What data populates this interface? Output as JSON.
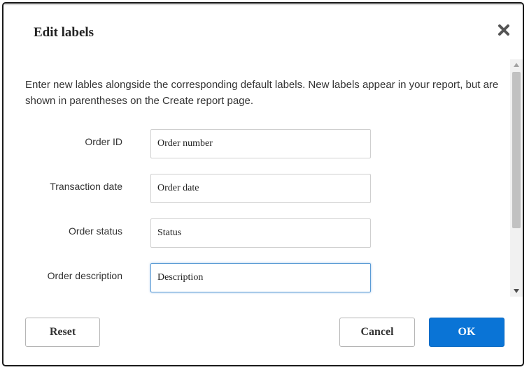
{
  "dialog": {
    "title": "Edit labels",
    "close_icon": "close-icon"
  },
  "intro_text": "Enter new lables alongside the corresponding default labels. New labels appear in your report, but are shown in parentheses on the Create report page.",
  "fields": [
    {
      "label": "Order ID",
      "value": "Order number"
    },
    {
      "label": "Transaction date",
      "value": "Order date"
    },
    {
      "label": "Order status",
      "value": "Status"
    },
    {
      "label": "Order description",
      "value": "Description"
    }
  ],
  "buttons": {
    "reset": "Reset",
    "cancel": "Cancel",
    "ok": "OK"
  },
  "colors": {
    "primary": "#0a74d6",
    "focus_border": "#5b9bd5"
  }
}
